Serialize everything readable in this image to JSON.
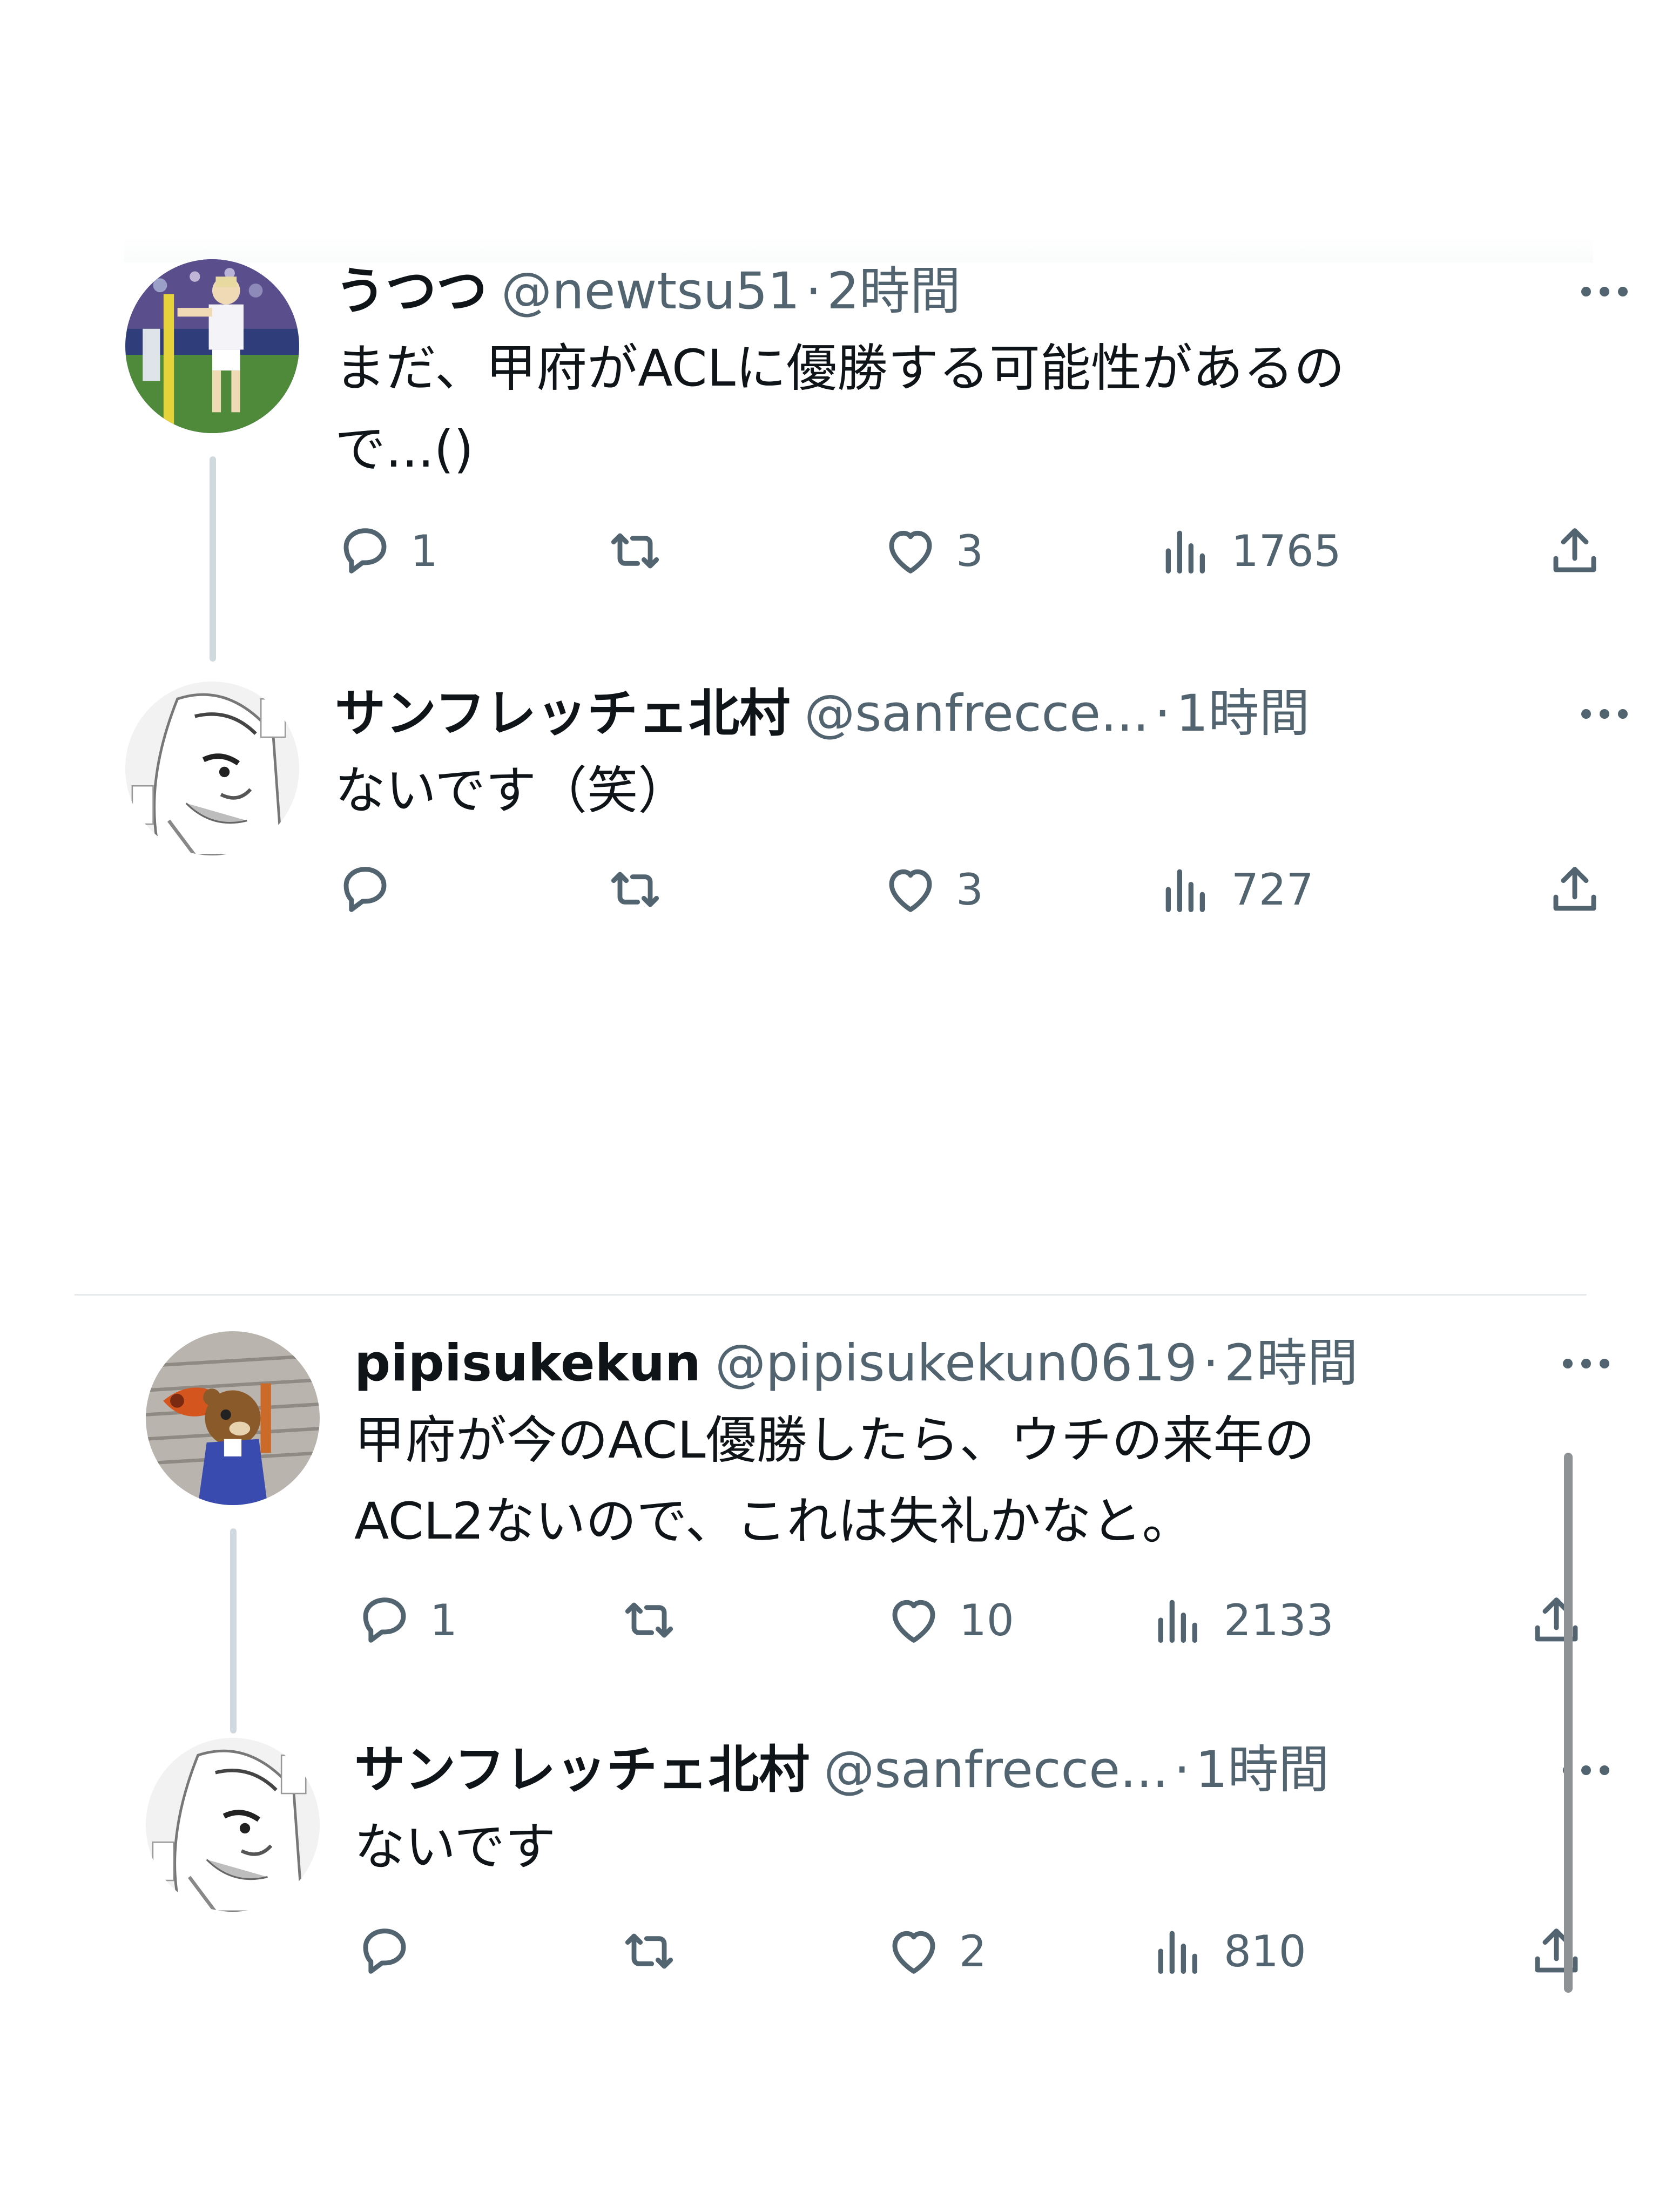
{
  "threads": [
    {
      "tweets": [
        {
          "avatar_icon": "soccer-player-avatar",
          "name": "うつつ",
          "handle": "@newtsu51",
          "separator": "·",
          "time": "2時間",
          "text_lines": [
            "まだ、甲府がACLに優勝する可能性があるの",
            "で...()"
          ],
          "reply_count": "1",
          "retweet_count": "",
          "like_count": "3",
          "view_count": "1765"
        },
        {
          "avatar_icon": "manga-face-avatar",
          "name": "サンフレッチェ北村",
          "handle": "@sanfrecce...",
          "separator": "·",
          "time": "1時間",
          "text_lines": [
            "ないです（笑）"
          ],
          "reply_count": "",
          "retweet_count": "",
          "like_count": "3",
          "view_count": "727"
        }
      ]
    },
    {
      "tweets": [
        {
          "avatar_icon": "mascot-avatar",
          "name": "pipisukekun",
          "handle": "@pipisukekun0619",
          "separator": "·",
          "time": "2時間",
          "text_lines": [
            "甲府が今のACL優勝したら、ウチの来年の",
            "ACL2ないので、これは失礼かなと。"
          ],
          "reply_count": "1",
          "retweet_count": "",
          "like_count": "10",
          "view_count": "2133"
        },
        {
          "avatar_icon": "manga-face-avatar",
          "name": "サンフレッチェ北村",
          "handle": "@sanfrecce...",
          "separator": "·",
          "time": "1時間",
          "text_lines": [
            "ないです"
          ],
          "reply_count": "",
          "retweet_count": "",
          "like_count": "2",
          "view_count": "810"
        }
      ]
    }
  ]
}
